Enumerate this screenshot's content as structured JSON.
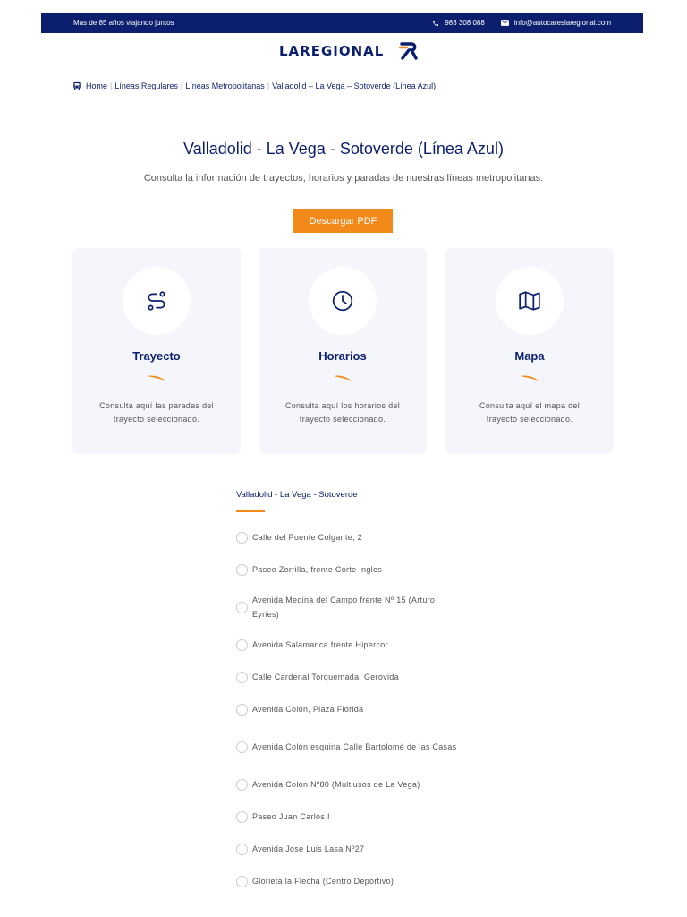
{
  "topbar": {
    "tagline": "Mas de 85 años viajando juntos",
    "phone": "983 308 088",
    "email": "info@autocareslaregional.com"
  },
  "logo": {
    "text": "LAREGIONAL"
  },
  "breadcrumb": [
    "Home",
    "Líneas Regulares",
    "Líneas Metropolitanas",
    "Valladolid – La Vega – Sotoverde (Línea Azul)"
  ],
  "page": {
    "title": "Valladolid - La Vega - Sotoverde (Línea Azul)",
    "subtitle": "Consulta la información de trayectos, horarios y paradas de nuestras líneas metropolitanas.",
    "pdf_button": "Descargar PDF"
  },
  "cards": [
    {
      "icon": "route-icon",
      "title": "Trayecto",
      "text": "Consulta aquí las paradas del trayecto seleccionado."
    },
    {
      "icon": "clock-icon",
      "title": "Horarios",
      "text": "Consulta aquí los horarios del trayecto seleccionado."
    },
    {
      "icon": "map-icon",
      "title": "Mapa",
      "text": "Consulta aquí el mapa del trayecto seleccionado."
    }
  ],
  "route": {
    "title": "Valladolid - La Vega - Sotoverde",
    "stops": [
      "Calle del Puente Colgante, 2",
      "Paseo Zorrilla, frente Corte Ingles",
      "Avenida Medina del Campo frente Nº 15 (Arturo Eyries)",
      "Avenida Salamanca frente Hipercor",
      "Calle Cardenal Torquemada, Gerovida",
      "Avenida Colón, Plaza Florida",
      "Avenida Colón esquina Calle Bartolomé de las Casas",
      "Avenida Colón Nº80 (Multiusos de La Vega)",
      "Paseo Juan Carlos I",
      "Avenida Jose Luis Lasa Nº27",
      "Glorieta la Flecha (Centro Deportivo)"
    ]
  },
  "colors": {
    "navy": "#0b1f6e",
    "orange": "#f28a1a",
    "card_bg": "#f4f6fb"
  }
}
